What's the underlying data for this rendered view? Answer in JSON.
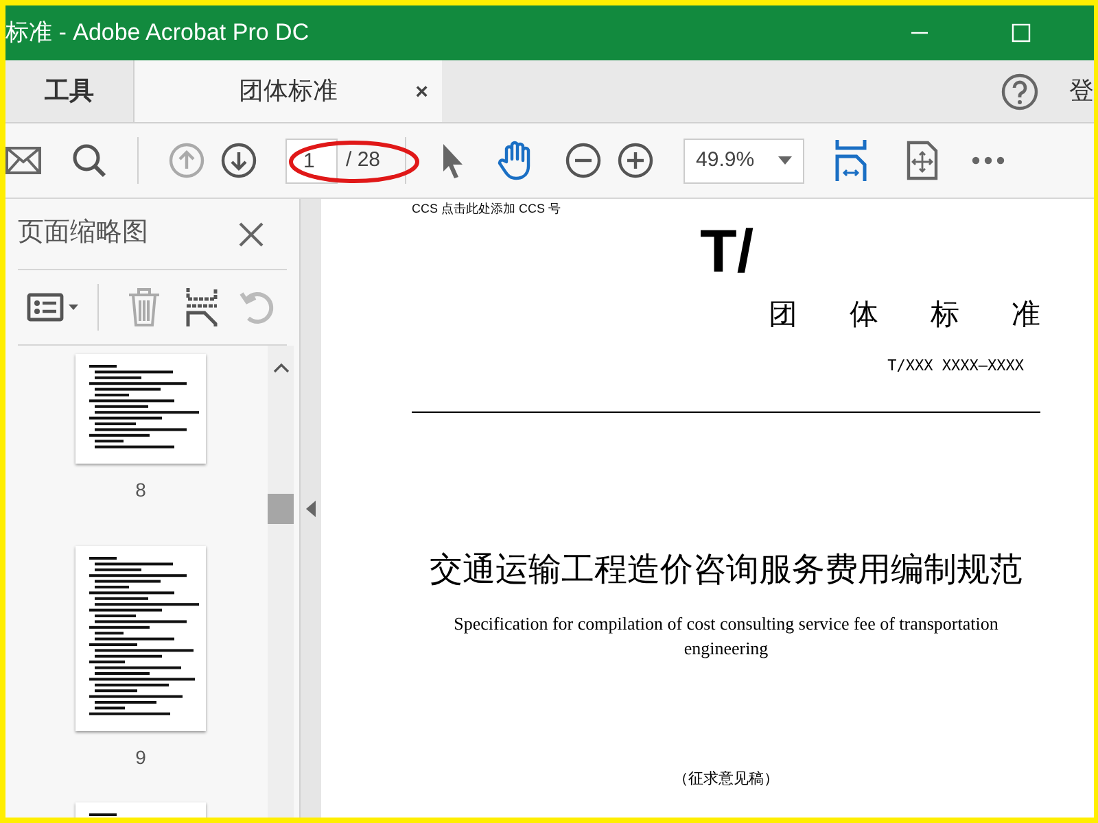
{
  "window": {
    "title": "标准 - Adobe Acrobat Pro DC"
  },
  "tabs": [
    {
      "label": "工具",
      "selected": false
    },
    {
      "label": "团体标准",
      "selected": true,
      "close": "×"
    }
  ],
  "account_label": "登",
  "toolbar": {
    "page_value": "1",
    "page_total": "/ 28",
    "zoom": "49.9%",
    "prev_disabled": true,
    "next_disabled": false
  },
  "sidebar": {
    "title": "页面缩略图",
    "thumbnails": [
      {
        "label": "8",
        "kind": "bottom"
      },
      {
        "label": "9",
        "kind": "full"
      },
      {
        "kind": "top"
      }
    ]
  },
  "document": {
    "ccs_line": "CCS 点击此处添加 CCS 号",
    "code_prefix": "T/",
    "standard_type": "团体标准",
    "doc_number": "T/XXX XXXX—XXXX",
    "title_cn": "交通运输工程造价咨询服务费用编制规范",
    "title_en": "Specification for compilation of cost consulting service fee of transportation engineering",
    "draft_note": "（征求意见稿）"
  }
}
